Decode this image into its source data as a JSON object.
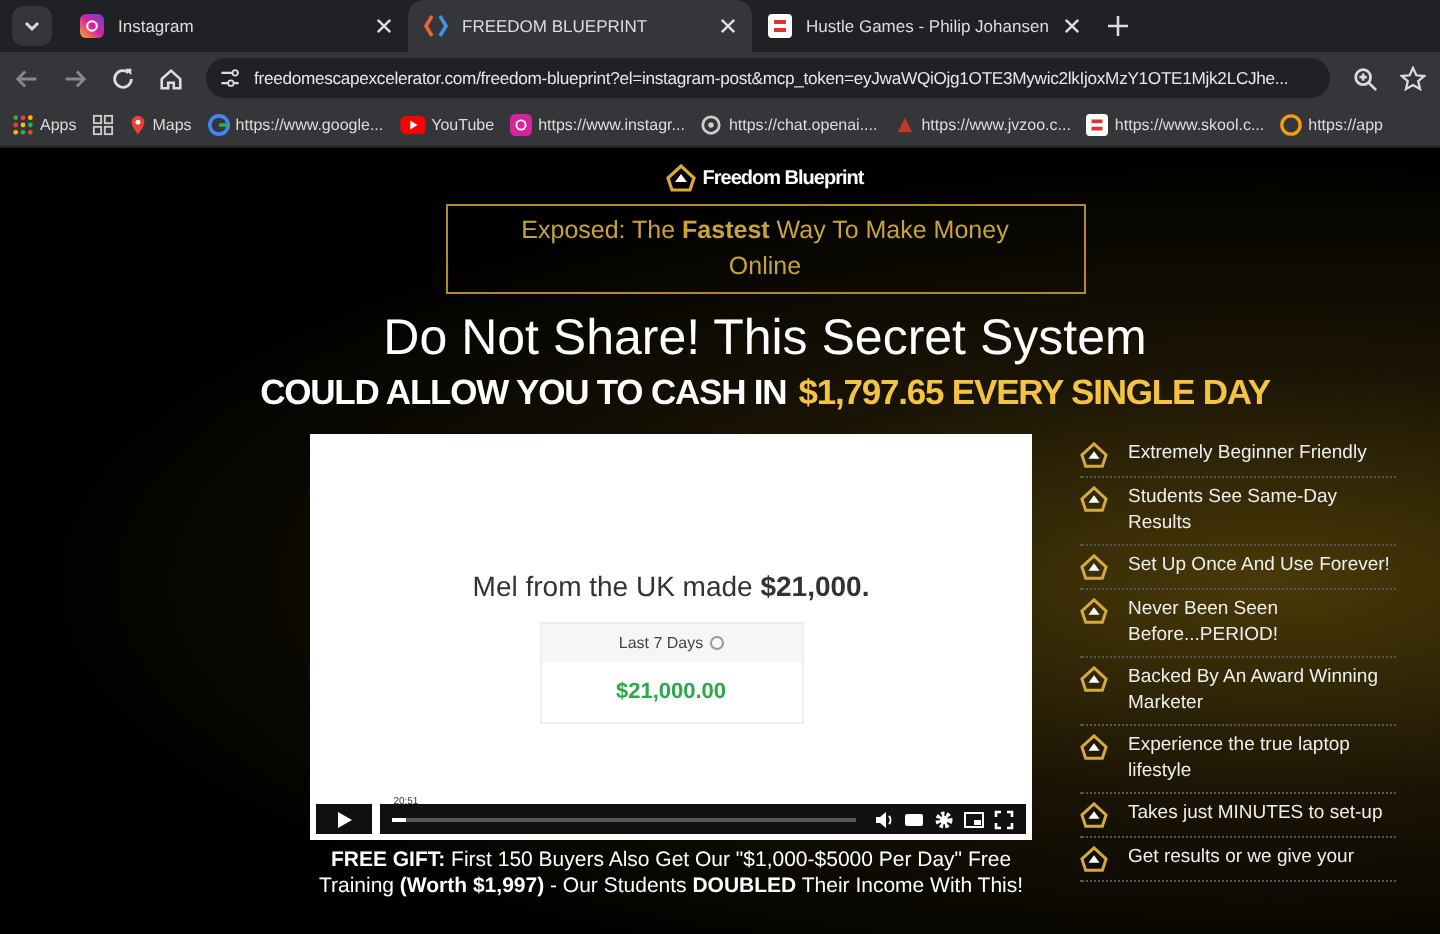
{
  "tabs": [
    {
      "title": "Instagram",
      "selected": false
    },
    {
      "title": "FREEDOM BLUEPRINT",
      "selected": true
    },
    {
      "title": "Hustle Games - Philip Johansen",
      "selected": false
    }
  ],
  "address_bar": {
    "url": "freedomescapexcelerator.com/freedom-blueprint?el=instagram-post&mcp_token=eyJwaWQiOjg1OTE3Mywic2lkIjoxMzY1OTE1Mjk2LCJhe..."
  },
  "bookmarks": [
    {
      "label": "Apps"
    },
    {
      "label": "Maps"
    },
    {
      "label": "https://www.google..."
    },
    {
      "label": "YouTube"
    },
    {
      "label": "https://www.instagr..."
    },
    {
      "label": "https://chat.openai...."
    },
    {
      "label": "https://www.jvzoo.c..."
    },
    {
      "label": "https://www.skool.c..."
    },
    {
      "label": "https://app"
    }
  ],
  "page": {
    "logo": "Freedom Blueprint",
    "banner": "Exposed: The **Fastest** Way To Make Money Online",
    "title": "Do Not Share! This Secret System",
    "headline_parts": [
      {
        "text": "COULD ALLOW YOU TO CASH IN",
        "highlight": false
      },
      {
        "text": "$1,797.65 EVERY SINGLE DAY",
        "highlight": true
      }
    ],
    "video": {
      "caption": "Mel from the UK made **$21,000.**",
      "card_label": "Last 7 Days",
      "card_amount": "$21,000.00",
      "time": "20:51",
      "level": 0.03
    },
    "features": [
      "Extremely Beginner Friendly",
      "Students See Same-Day Results",
      "Set Up Once And Use Forever!",
      "Never Been Seen Before...PERIOD!",
      "Backed By An Award Winning Marketer",
      "Experience the true laptop lifestyle",
      "Takes just MINUTES to set-up",
      "Get results or we give your"
    ],
    "gift": "**FREE GIFT:** First 150 Buyers Also Get Our \"$1,000-$5000 Per Day\" Free Training **(Worth $1,997)** - Our Students **DOUBLED** Their Income With This!"
  }
}
